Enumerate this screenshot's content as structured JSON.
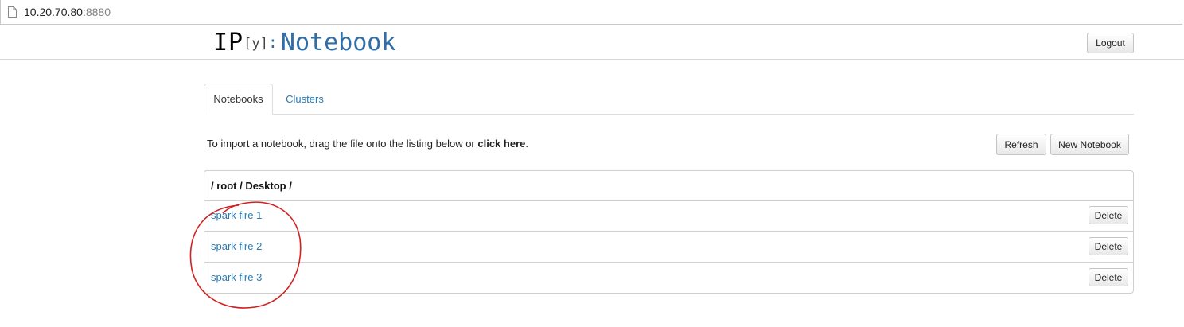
{
  "browser": {
    "url_host": "10.20.70.80",
    "url_port": ":8880"
  },
  "header": {
    "logo_ip": "IP",
    "logo_y": "[y]",
    "logo_colon": ":",
    "logo_notebook": "Notebook",
    "logout_label": "Logout"
  },
  "tabs": [
    {
      "label": "Notebooks",
      "active": true
    },
    {
      "label": "Clusters",
      "active": false
    }
  ],
  "toolbar": {
    "import_text": "To import a notebook, drag the file onto the listing below or ",
    "import_link": "click here",
    "import_end": ".",
    "refresh_label": "Refresh",
    "new_notebook_label": "New Notebook"
  },
  "listing": {
    "path": "/ root / Desktop /",
    "notebooks": [
      {
        "name": "spark fire 1",
        "delete_label": "Delete"
      },
      {
        "name": "spark fire 2",
        "delete_label": "Delete"
      },
      {
        "name": "spark fire 3",
        "delete_label": "Delete"
      }
    ]
  },
  "colors": {
    "link": "#2a7ab0",
    "logo_blue": "#2f6ea8",
    "annotation": "#d42020"
  }
}
